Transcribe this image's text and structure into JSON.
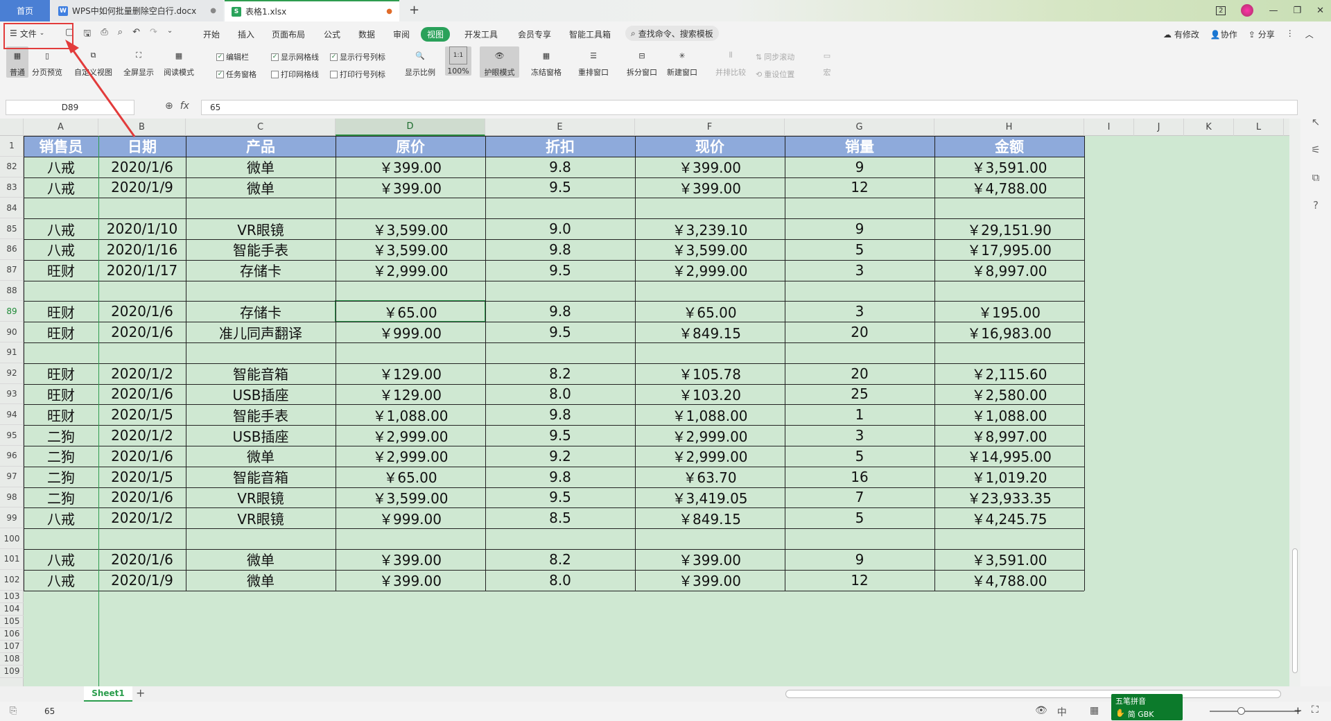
{
  "tabs": {
    "home": "首页",
    "doc": "WPS中如何批量删除空白行.docx",
    "xls": "表格1.xlsx",
    "close": "●",
    "new": "+",
    "doc_icon": "W",
    "xls_icon": "S"
  },
  "window": {
    "badge": "2",
    "minimize": "—",
    "restore": "❐",
    "close": "✕"
  },
  "menu": {
    "file": "文件",
    "items": [
      "开始",
      "插入",
      "页面布局",
      "公式",
      "数据",
      "审阅",
      "视图",
      "开发工具",
      "会员专享",
      "智能工具箱"
    ],
    "search": "查找命令、搜索模板",
    "right": [
      "有修改",
      "协作",
      "分享"
    ]
  },
  "ribbon": {
    "buttons": [
      "普通",
      "分页预览",
      "自定义视图",
      "全屏显示",
      "阅读模式"
    ],
    "checks": [
      {
        "label": "编辑栏",
        "checked": true
      },
      {
        "label": "显示网格线",
        "checked": true
      },
      {
        "label": "显示行号列标",
        "checked": true
      },
      {
        "label": "任务窗格",
        "checked": true
      },
      {
        "label": "打印网格线",
        "checked": false
      },
      {
        "label": "打印行号列标",
        "checked": false
      }
    ],
    "tools": [
      "显示比例",
      "100%",
      "护眼模式",
      "冻结窗格",
      "重排窗口",
      "拆分窗口",
      "新建窗口",
      "并排比较",
      "宏"
    ],
    "disabled": [
      "同步滚动",
      "重设位置"
    ],
    "zoom_icon_text": "1:1"
  },
  "formula": {
    "cell_ref": "D89",
    "fx": "fx",
    "value": "65"
  },
  "columns": [
    "A",
    "B",
    "C",
    "D",
    "E",
    "F",
    "G",
    "H",
    "I",
    "J",
    "K",
    "L"
  ],
  "header_row": {
    "row": "1",
    "cells": [
      "销售员",
      "日期",
      "产品",
      "原价",
      "折扣",
      "现价",
      "销量",
      "金额"
    ]
  },
  "rows": [
    {
      "n": "82",
      "c": [
        "八戒",
        "2020/1/6",
        "微单",
        "￥399.00",
        "9.8",
        "￥399.00",
        "9",
        "￥3,591.00"
      ]
    },
    {
      "n": "83",
      "c": [
        "八戒",
        "2020/1/9",
        "微单",
        "￥399.00",
        "9.5",
        "￥399.00",
        "12",
        "￥4,788.00"
      ]
    },
    {
      "n": "84",
      "c": [
        "",
        "",
        "",
        "",
        "",
        "",
        "",
        ""
      ]
    },
    {
      "n": "85",
      "c": [
        "八戒",
        "2020/1/10",
        "VR眼镜",
        "￥3,599.00",
        "9.0",
        "￥3,239.10",
        "9",
        "￥29,151.90"
      ]
    },
    {
      "n": "86",
      "c": [
        "八戒",
        "2020/1/16",
        "智能手表",
        "￥3,599.00",
        "9.8",
        "￥3,599.00",
        "5",
        "￥17,995.00"
      ]
    },
    {
      "n": "87",
      "c": [
        "旺财",
        "2020/1/17",
        "存储卡",
        "￥2,999.00",
        "9.5",
        "￥2,999.00",
        "3",
        "￥8,997.00"
      ]
    },
    {
      "n": "88",
      "c": [
        "",
        "",
        "",
        "",
        "",
        "",
        "",
        ""
      ]
    },
    {
      "n": "89",
      "c": [
        "旺财",
        "2020/1/6",
        "存储卡",
        "￥65.00",
        "9.8",
        "￥65.00",
        "3",
        "￥195.00"
      ]
    },
    {
      "n": "90",
      "c": [
        "旺财",
        "2020/1/6",
        "准儿同声翻译",
        "￥999.00",
        "9.5",
        "￥849.15",
        "20",
        "￥16,983.00"
      ]
    },
    {
      "n": "91",
      "c": [
        "",
        "",
        "",
        "",
        "",
        "",
        "",
        ""
      ]
    },
    {
      "n": "92",
      "c": [
        "旺财",
        "2020/1/2",
        "智能音箱",
        "￥129.00",
        "8.2",
        "￥105.78",
        "20",
        "￥2,115.60"
      ]
    },
    {
      "n": "93",
      "c": [
        "旺财",
        "2020/1/6",
        "USB插座",
        "￥129.00",
        "8.0",
        "￥103.20",
        "25",
        "￥2,580.00"
      ]
    },
    {
      "n": "94",
      "c": [
        "旺财",
        "2020/1/5",
        "智能手表",
        "￥1,088.00",
        "9.8",
        "￥1,088.00",
        "1",
        "￥1,088.00"
      ]
    },
    {
      "n": "95",
      "c": [
        "二狗",
        "2020/1/2",
        "USB插座",
        "￥2,999.00",
        "9.5",
        "￥2,999.00",
        "3",
        "￥8,997.00"
      ]
    },
    {
      "n": "96",
      "c": [
        "二狗",
        "2020/1/6",
        "微单",
        "￥2,999.00",
        "9.2",
        "￥2,999.00",
        "5",
        "￥14,995.00"
      ]
    },
    {
      "n": "97",
      "c": [
        "二狗",
        "2020/1/5",
        "智能音箱",
        "￥65.00",
        "9.8",
        "￥63.70",
        "16",
        "￥1,019.20"
      ]
    },
    {
      "n": "98",
      "c": [
        "二狗",
        "2020/1/6",
        "VR眼镜",
        "￥3,599.00",
        "9.5",
        "￥3,419.05",
        "7",
        "￥23,933.35"
      ]
    },
    {
      "n": "99",
      "c": [
        "八戒",
        "2020/1/2",
        "VR眼镜",
        "￥999.00",
        "8.5",
        "￥849.15",
        "5",
        "￥4,245.75"
      ]
    },
    {
      "n": "100",
      "c": [
        "",
        "",
        "",
        "",
        "",
        "",
        "",
        ""
      ]
    },
    {
      "n": "101",
      "c": [
        "八戒",
        "2020/1/6",
        "微单",
        "￥399.00",
        "8.2",
        "￥399.00",
        "9",
        "￥3,591.00"
      ]
    },
    {
      "n": "102",
      "c": [
        "八戒",
        "2020/1/9",
        "微单",
        "￥399.00",
        "8.0",
        "￥399.00",
        "12",
        "￥4,788.00"
      ]
    }
  ],
  "empty_rows": [
    "103",
    "104",
    "105",
    "106",
    "107",
    "108",
    "109"
  ],
  "selected_cell": {
    "row": "89",
    "col": "D"
  },
  "sheet_tab": "Sheet1",
  "status": {
    "value": "65",
    "ime_line1": "五笔拼音",
    "ime_line2": "简 GBK"
  },
  "colors": {
    "header_fill": "#8eaadb",
    "sheet_bg": "#cfe8d2",
    "accent": "#2aa15a",
    "annotation": "#e23b3b"
  }
}
